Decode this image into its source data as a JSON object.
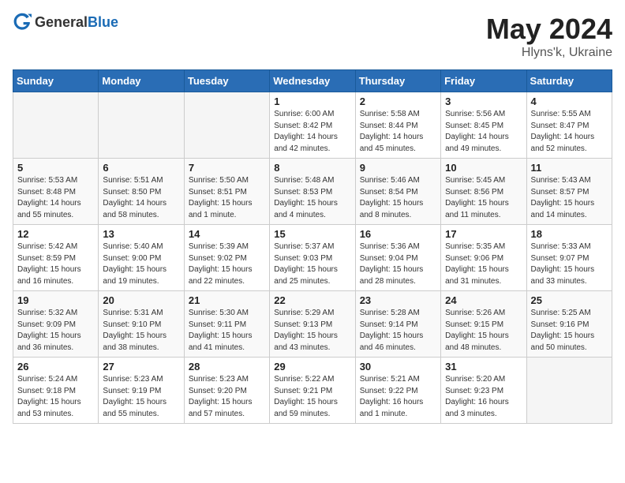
{
  "header": {
    "logo_general": "General",
    "logo_blue": "Blue",
    "title": "May 2024",
    "location": "Hlyns'k, Ukraine"
  },
  "weekdays": [
    "Sunday",
    "Monday",
    "Tuesday",
    "Wednesday",
    "Thursday",
    "Friday",
    "Saturday"
  ],
  "weeks": [
    [
      {
        "day": "",
        "info": ""
      },
      {
        "day": "",
        "info": ""
      },
      {
        "day": "",
        "info": ""
      },
      {
        "day": "1",
        "info": "Sunrise: 6:00 AM\nSunset: 8:42 PM\nDaylight: 14 hours\nand 42 minutes."
      },
      {
        "day": "2",
        "info": "Sunrise: 5:58 AM\nSunset: 8:44 PM\nDaylight: 14 hours\nand 45 minutes."
      },
      {
        "day": "3",
        "info": "Sunrise: 5:56 AM\nSunset: 8:45 PM\nDaylight: 14 hours\nand 49 minutes."
      },
      {
        "day": "4",
        "info": "Sunrise: 5:55 AM\nSunset: 8:47 PM\nDaylight: 14 hours\nand 52 minutes."
      }
    ],
    [
      {
        "day": "5",
        "info": "Sunrise: 5:53 AM\nSunset: 8:48 PM\nDaylight: 14 hours\nand 55 minutes."
      },
      {
        "day": "6",
        "info": "Sunrise: 5:51 AM\nSunset: 8:50 PM\nDaylight: 14 hours\nand 58 minutes."
      },
      {
        "day": "7",
        "info": "Sunrise: 5:50 AM\nSunset: 8:51 PM\nDaylight: 15 hours\nand 1 minute."
      },
      {
        "day": "8",
        "info": "Sunrise: 5:48 AM\nSunset: 8:53 PM\nDaylight: 15 hours\nand 4 minutes."
      },
      {
        "day": "9",
        "info": "Sunrise: 5:46 AM\nSunset: 8:54 PM\nDaylight: 15 hours\nand 8 minutes."
      },
      {
        "day": "10",
        "info": "Sunrise: 5:45 AM\nSunset: 8:56 PM\nDaylight: 15 hours\nand 11 minutes."
      },
      {
        "day": "11",
        "info": "Sunrise: 5:43 AM\nSunset: 8:57 PM\nDaylight: 15 hours\nand 14 minutes."
      }
    ],
    [
      {
        "day": "12",
        "info": "Sunrise: 5:42 AM\nSunset: 8:59 PM\nDaylight: 15 hours\nand 16 minutes."
      },
      {
        "day": "13",
        "info": "Sunrise: 5:40 AM\nSunset: 9:00 PM\nDaylight: 15 hours\nand 19 minutes."
      },
      {
        "day": "14",
        "info": "Sunrise: 5:39 AM\nSunset: 9:02 PM\nDaylight: 15 hours\nand 22 minutes."
      },
      {
        "day": "15",
        "info": "Sunrise: 5:37 AM\nSunset: 9:03 PM\nDaylight: 15 hours\nand 25 minutes."
      },
      {
        "day": "16",
        "info": "Sunrise: 5:36 AM\nSunset: 9:04 PM\nDaylight: 15 hours\nand 28 minutes."
      },
      {
        "day": "17",
        "info": "Sunrise: 5:35 AM\nSunset: 9:06 PM\nDaylight: 15 hours\nand 31 minutes."
      },
      {
        "day": "18",
        "info": "Sunrise: 5:33 AM\nSunset: 9:07 PM\nDaylight: 15 hours\nand 33 minutes."
      }
    ],
    [
      {
        "day": "19",
        "info": "Sunrise: 5:32 AM\nSunset: 9:09 PM\nDaylight: 15 hours\nand 36 minutes."
      },
      {
        "day": "20",
        "info": "Sunrise: 5:31 AM\nSunset: 9:10 PM\nDaylight: 15 hours\nand 38 minutes."
      },
      {
        "day": "21",
        "info": "Sunrise: 5:30 AM\nSunset: 9:11 PM\nDaylight: 15 hours\nand 41 minutes."
      },
      {
        "day": "22",
        "info": "Sunrise: 5:29 AM\nSunset: 9:13 PM\nDaylight: 15 hours\nand 43 minutes."
      },
      {
        "day": "23",
        "info": "Sunrise: 5:28 AM\nSunset: 9:14 PM\nDaylight: 15 hours\nand 46 minutes."
      },
      {
        "day": "24",
        "info": "Sunrise: 5:26 AM\nSunset: 9:15 PM\nDaylight: 15 hours\nand 48 minutes."
      },
      {
        "day": "25",
        "info": "Sunrise: 5:25 AM\nSunset: 9:16 PM\nDaylight: 15 hours\nand 50 minutes."
      }
    ],
    [
      {
        "day": "26",
        "info": "Sunrise: 5:24 AM\nSunset: 9:18 PM\nDaylight: 15 hours\nand 53 minutes."
      },
      {
        "day": "27",
        "info": "Sunrise: 5:23 AM\nSunset: 9:19 PM\nDaylight: 15 hours\nand 55 minutes."
      },
      {
        "day": "28",
        "info": "Sunrise: 5:23 AM\nSunset: 9:20 PM\nDaylight: 15 hours\nand 57 minutes."
      },
      {
        "day": "29",
        "info": "Sunrise: 5:22 AM\nSunset: 9:21 PM\nDaylight: 15 hours\nand 59 minutes."
      },
      {
        "day": "30",
        "info": "Sunrise: 5:21 AM\nSunset: 9:22 PM\nDaylight: 16 hours\nand 1 minute."
      },
      {
        "day": "31",
        "info": "Sunrise: 5:20 AM\nSunset: 9:23 PM\nDaylight: 16 hours\nand 3 minutes."
      },
      {
        "day": "",
        "info": ""
      }
    ]
  ]
}
